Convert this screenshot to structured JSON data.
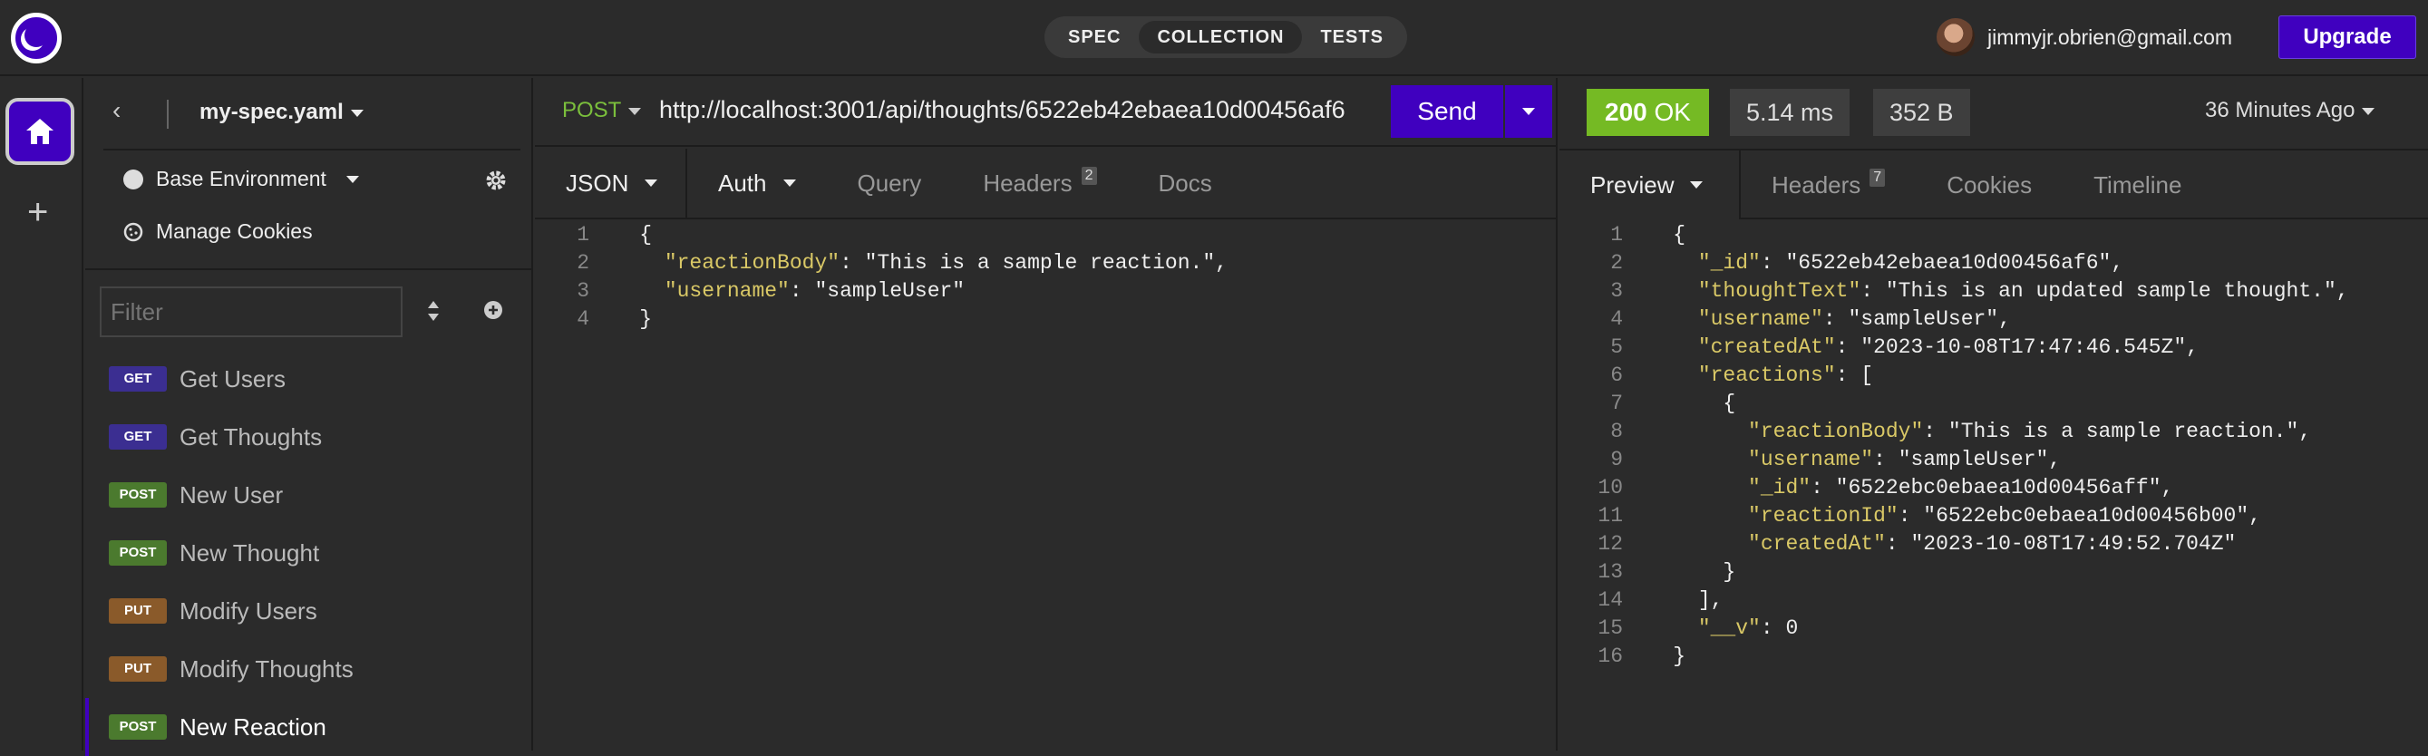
{
  "topbar": {
    "tabs": [
      "SPEC",
      "COLLECTION",
      "TESTS"
    ],
    "active_tab": "COLLECTION",
    "user_email": "jimmyjr.obrien@gmail.com",
    "upgrade_label": "Upgrade"
  },
  "sidebar": {
    "spec_name": "my-spec.yaml",
    "environment": "Base Environment",
    "manage_cookies": "Manage Cookies",
    "filter_placeholder": "Filter",
    "requests": [
      {
        "method": "GET",
        "name": "Get Users"
      },
      {
        "method": "GET",
        "name": "Get Thoughts"
      },
      {
        "method": "POST",
        "name": "New User"
      },
      {
        "method": "POST",
        "name": "New Thought"
      },
      {
        "method": "PUT",
        "name": "Modify Users"
      },
      {
        "method": "PUT",
        "name": "Modify Thoughts"
      },
      {
        "method": "POST",
        "name": "New Reaction"
      }
    ]
  },
  "request": {
    "method": "POST",
    "url": "http://localhost:3001/api/thoughts/6522eb42ebaea10d00456af6",
    "send_label": "Send",
    "tabs": {
      "body": "JSON",
      "auth": "Auth",
      "query": "Query",
      "headers": "Headers",
      "headers_count": "2",
      "docs": "Docs"
    },
    "body_lines": [
      "{",
      "  \"reactionBody\": \"This is a sample reaction.\",",
      "  \"username\": \"sampleUser\"",
      "}"
    ]
  },
  "response": {
    "status_code": "200",
    "status_text": "OK",
    "time": "5.14 ms",
    "size": "352 B",
    "ago": "36 Minutes Ago",
    "tabs": {
      "preview": "Preview",
      "headers": "Headers",
      "headers_count": "7",
      "cookies": "Cookies",
      "timeline": "Timeline"
    },
    "body_lines": [
      "{",
      "  \"_id\": \"6522eb42ebaea10d00456af6\",",
      "  \"thoughtText\": \"This is an updated sample thought.\",",
      "  \"username\": \"sampleUser\",",
      "  \"createdAt\": \"2023-10-08T17:47:46.545Z\",",
      "  \"reactions\": [",
      "    {",
      "      \"reactionBody\": \"This is a sample reaction.\",",
      "      \"username\": \"sampleUser\",",
      "      \"_id\": \"6522ebc0ebaea10d00456aff\",",
      "      \"reactionId\": \"6522ebc0ebaea10d00456b00\",",
      "      \"createdAt\": \"2023-10-08T17:49:52.704Z\"",
      "    }",
      "  ],",
      "  \"__v\": 0",
      "}"
    ]
  },
  "colors": {
    "accent": "#4000bf",
    "ok": "#75ba24",
    "string": "#f2e74a"
  }
}
